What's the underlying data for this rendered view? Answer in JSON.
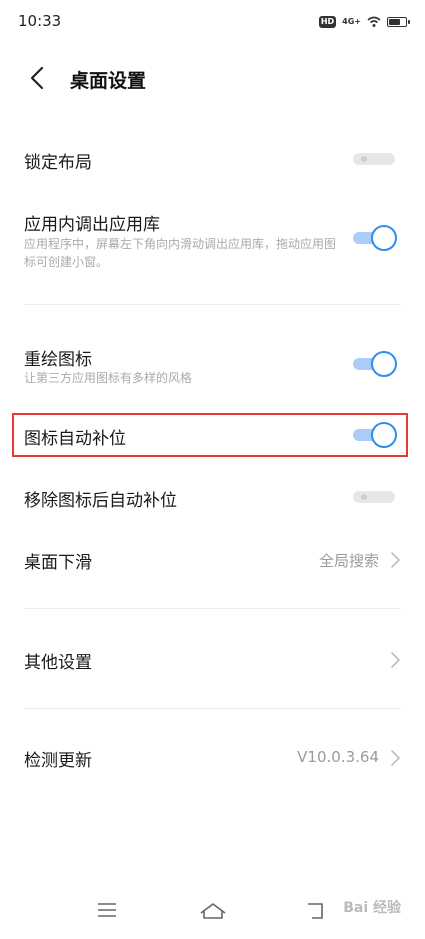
{
  "status_bar": {
    "time": "10:33",
    "hd": "HD",
    "network": "4G+"
  },
  "header": {
    "title": "桌面设置"
  },
  "rows": {
    "lock_layout": {
      "label": "锁定布局",
      "state": "off"
    },
    "app_library": {
      "label": "应用内调出应用库",
      "desc": "应用程序中，屏幕左下角向内滑动调出应用库，拖动应用图标可创建小窗。",
      "state": "on"
    },
    "redraw_icons": {
      "label": "重绘图标",
      "desc": "让第三方应用图标有多样的风格",
      "state": "on"
    },
    "auto_fill": {
      "label": "图标自动补位",
      "state": "on"
    },
    "auto_fill_after_remove": {
      "label": "移除图标后自动补位",
      "state": "off"
    },
    "desktop_swipe": {
      "label": "桌面下滑",
      "value": "全局搜索"
    },
    "other_settings": {
      "label": "其他设置"
    },
    "check_update": {
      "label": "检测更新",
      "value": "V10.0.3.64"
    }
  },
  "watermark": "Bai 经验",
  "colors": {
    "accent": "#2f8cf0",
    "highlight": "#e53935"
  }
}
